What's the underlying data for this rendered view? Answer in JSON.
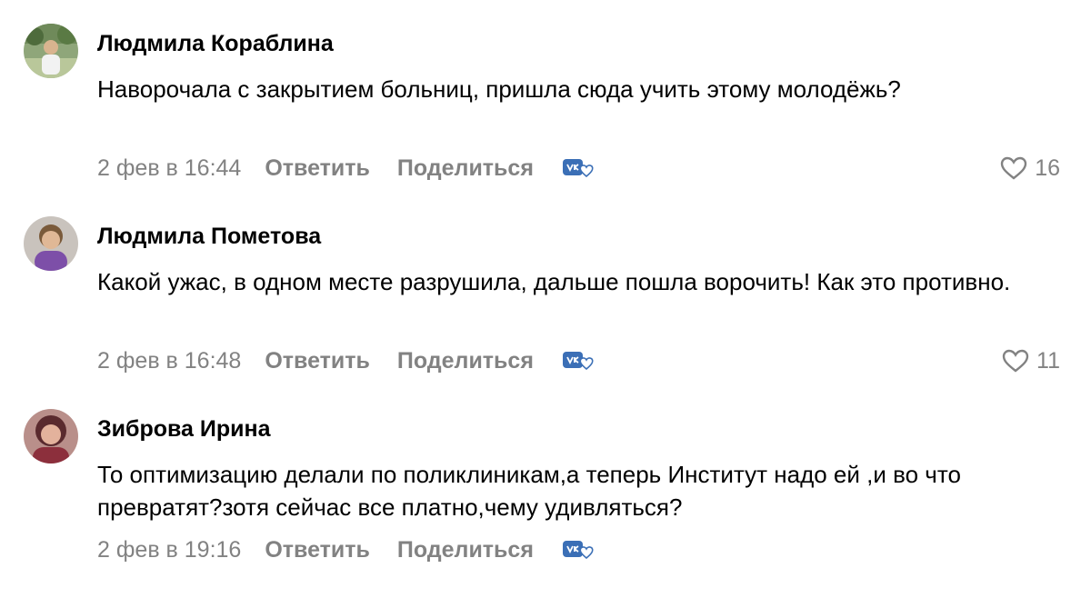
{
  "comments": [
    {
      "author": "Людмила Кораблина",
      "text": "Наворочала с закрытием больниц, пришла сюда учить этому молодёжь?",
      "date": "2 фев в 16:44",
      "reply_label": "Ответить",
      "share_label": "Поделиться",
      "likes": "16"
    },
    {
      "author": "Людмила Пометова",
      "text": "Какой ужас, в одном месте разрушила, дальше пошла ворочить! Как это противно.",
      "date": "2 фев в 16:48",
      "reply_label": "Ответить",
      "share_label": "Поделиться",
      "likes": "11"
    },
    {
      "author": "Зиброва Ирина",
      "text": "То оптимизацию делали по поликлиникам,а теперь Институт надо ей ,и во что превратят?зотя сейчас все платно,чему удивляться?",
      "date": "2 фев в 19:16",
      "reply_label": "Ответить",
      "share_label": "Поделиться"
    }
  ],
  "icons": {
    "like": "heart-icon",
    "share_app": "vk-share-icon"
  },
  "colors": {
    "meta": "#828282",
    "vk_blue": "#3b6fb6",
    "text": "#000000"
  }
}
